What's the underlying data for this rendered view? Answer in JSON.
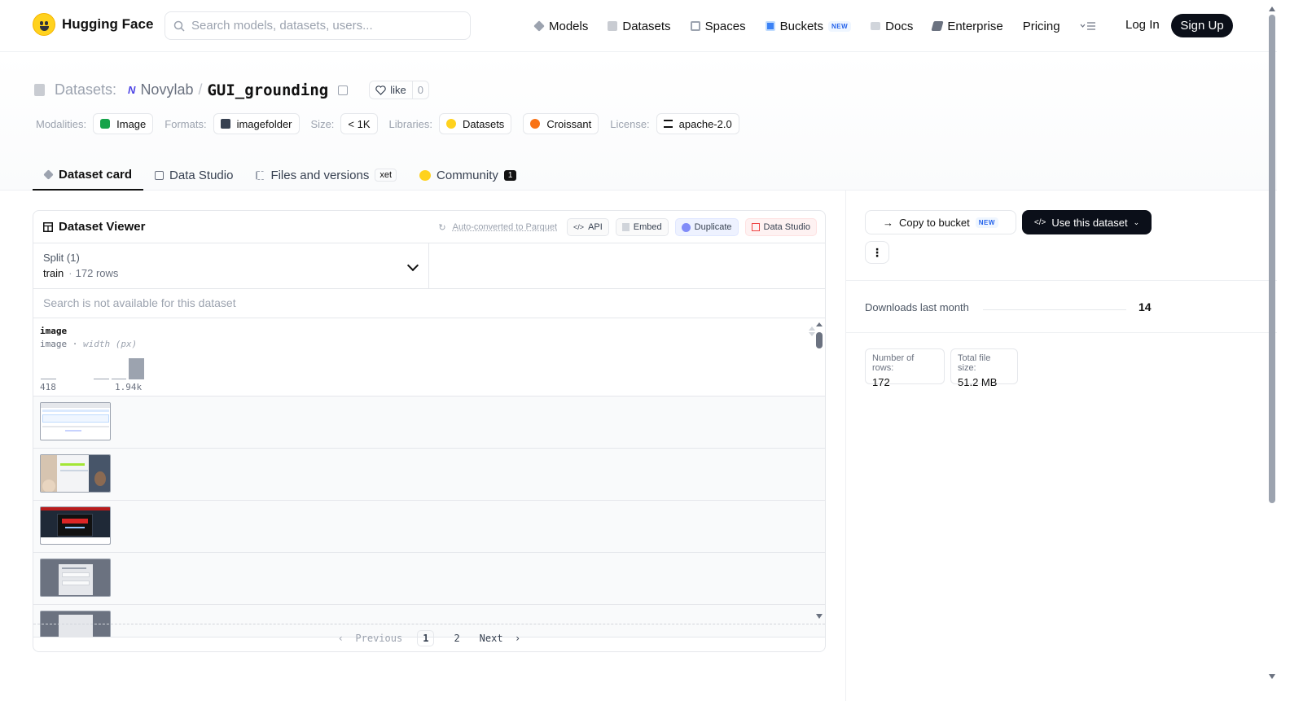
{
  "nav": {
    "brand": "Hugging Face",
    "search_placeholder": "Search models, datasets, users...",
    "links": [
      {
        "label": "Models",
        "icon": "cube-icon"
      },
      {
        "label": "Datasets",
        "icon": "database-icon"
      },
      {
        "label": "Spaces",
        "icon": "grid-icon"
      },
      {
        "label": "Buckets",
        "icon": "bucket-icon",
        "badge": "NEW"
      },
      {
        "label": "Docs",
        "icon": "book-icon"
      },
      {
        "label": "Enterprise",
        "icon": "enterprise-icon"
      },
      {
        "label": "Pricing"
      }
    ],
    "login": "Log In",
    "signup": "Sign Up"
  },
  "header": {
    "prefix": "Datasets:",
    "owner": "Novylab",
    "name": "GUI_grounding",
    "like_label": "like",
    "like_count": "0",
    "meta": {
      "modalities_label": "Modalities:",
      "modality": "Image",
      "formats_label": "Formats:",
      "format": "imagefolder",
      "size_label": "Size:",
      "size": "< 1K",
      "libraries_label": "Libraries:",
      "library1": "Datasets",
      "library2": "Croissant",
      "license_label": "License:",
      "license": "apache-2.0"
    },
    "tabs": [
      {
        "label": "Dataset card",
        "active": true
      },
      {
        "label": "Data Studio"
      },
      {
        "label": "Files and versions",
        "badge": "xet"
      },
      {
        "label": "Community",
        "count": "1"
      }
    ]
  },
  "viewer": {
    "title": "Dataset Viewer",
    "auto_converted": "Auto-converted to Parquet",
    "api": "API",
    "embed": "Embed",
    "duplicate": "Duplicate",
    "data_studio": "Data Studio",
    "split_label": "Split (1)",
    "split_name": "train",
    "split_rows": "172 rows",
    "search_na": "Search is not available for this dataset",
    "column": {
      "name": "image",
      "type": "image",
      "type_detail": "width (px)",
      "min_label": "418",
      "max_label": "1.94k",
      "hist": [
        0.05,
        0,
        0,
        0.05,
        0.05,
        1.0
      ]
    },
    "pager": {
      "prev": "Previous",
      "pages": [
        "1",
        "2"
      ],
      "current": "1",
      "next": "Next"
    }
  },
  "sidebar": {
    "copy_bucket": "Copy to bucket",
    "copy_bucket_badge": "NEW",
    "use_dataset": "Use this dataset",
    "downloads_label": "Downloads last month",
    "downloads_value": "14",
    "rows_label": "Number of rows:",
    "rows_value": "172",
    "filesize_label": "Total file size:",
    "filesize_value": "51.2 MB"
  },
  "colors": {
    "accent_dark": "#0b0f19",
    "brand_yellow": "#ffd21e"
  }
}
